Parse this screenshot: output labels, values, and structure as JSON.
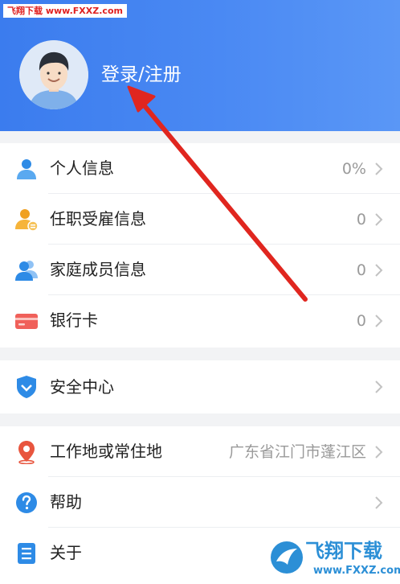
{
  "watermark_top": "飞翔下载 www.FXXZ.com",
  "header": {
    "login_label": "登录/注册"
  },
  "groups": [
    {
      "rows": [
        {
          "label": "个人信息",
          "value": "0%",
          "icon": "person-icon"
        },
        {
          "label": "任职受雇信息",
          "value": "0",
          "icon": "employment-icon"
        },
        {
          "label": "家庭成员信息",
          "value": "0",
          "icon": "family-icon"
        },
        {
          "label": "银行卡",
          "value": "0",
          "icon": "bank-card-icon"
        }
      ]
    },
    {
      "rows": [
        {
          "label": "安全中心",
          "value": "",
          "icon": "shield-icon"
        }
      ]
    },
    {
      "rows": [
        {
          "label": "工作地或常住地",
          "value": "广东省江门市蓬江区",
          "icon": "location-pin-icon"
        },
        {
          "label": "帮助",
          "value": "",
          "icon": "help-icon"
        },
        {
          "label": "关于",
          "value": "",
          "icon": "about-icon"
        }
      ]
    }
  ],
  "logo_watermark": {
    "main": "飞翔下载",
    "sub": "www.FXXZ.com"
  },
  "colors": {
    "header_blue": "#3b7cee",
    "annotation_red": "#e0261f"
  }
}
